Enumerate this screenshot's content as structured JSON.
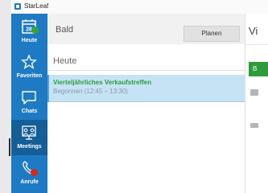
{
  "window": {
    "title": "StarLeaf"
  },
  "sidebar": {
    "items": [
      {
        "label": "Heute",
        "icon": "calendar-icon",
        "date": "28",
        "active": false
      },
      {
        "label": "Favoriten",
        "icon": "star-icon",
        "active": false
      },
      {
        "label": "Chats",
        "icon": "chat-bubble-icon",
        "active": false
      },
      {
        "label": "Meetings",
        "icon": "meeting-room-icon",
        "active": true
      },
      {
        "label": "Anrufe",
        "icon": "phone-icon",
        "active": false
      }
    ]
  },
  "main": {
    "header_title": "Bald",
    "plan_button": "Planen",
    "section_heading": "Heute",
    "meetings": [
      {
        "title": "Vierteljährliches Verkaufstreffen",
        "status": "Begonnen (12:45 – 13:30)"
      }
    ]
  },
  "detail": {
    "title_partial": "Vi",
    "button_partial": "B"
  },
  "colors": {
    "sidebar_blue": "#1e7ac2",
    "sidebar_active": "#155e97",
    "meeting_title_green": "#2e9b3c",
    "selected_row": "#c6e3f5",
    "badge_green": "#3aa13a",
    "badge_red": "#d42a1f"
  }
}
